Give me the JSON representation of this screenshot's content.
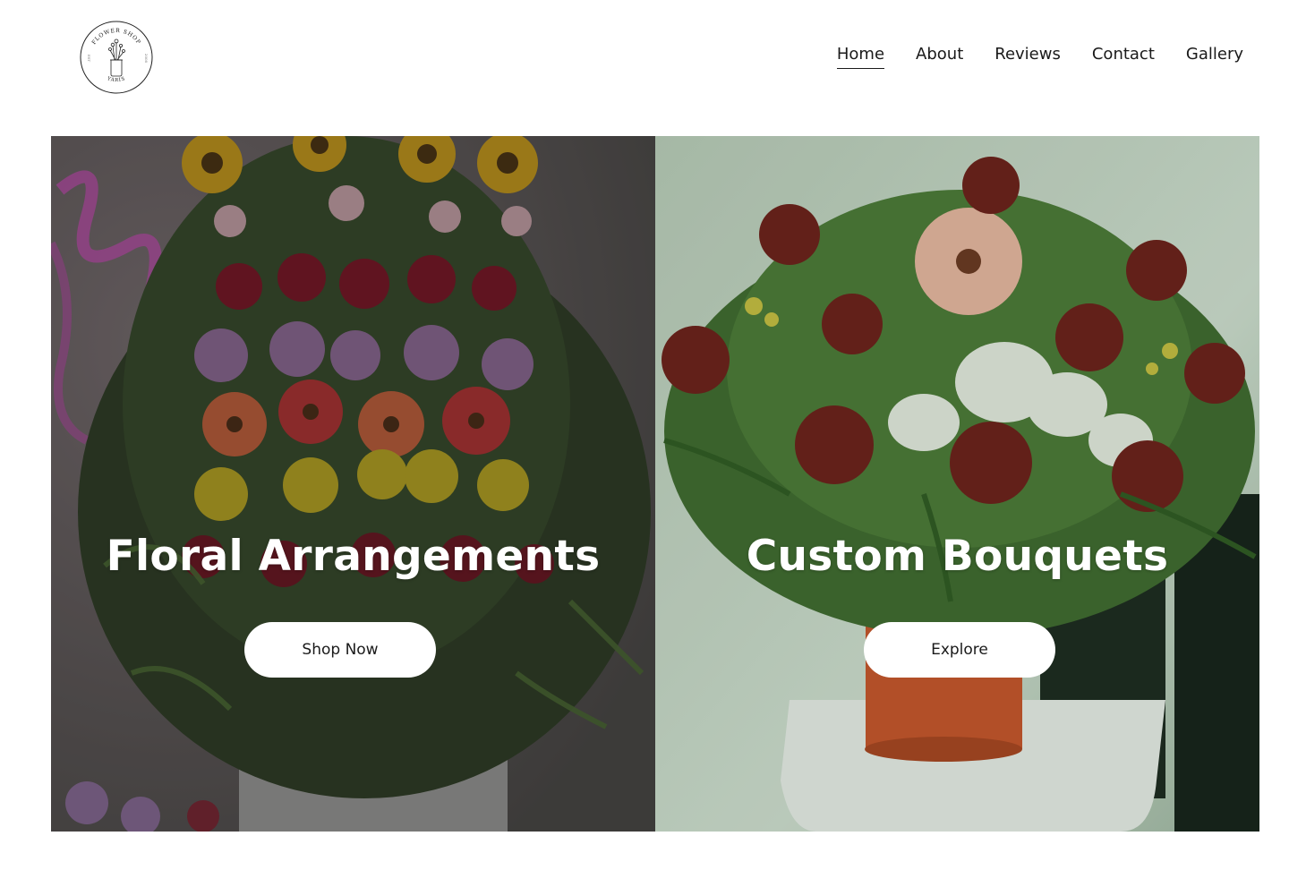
{
  "logo": {
    "top_text": "FLOWER SHOP",
    "bottom_text": "YARIS",
    "left_text": "EST",
    "right_text": "2008",
    "icon": "flower-vase-icon"
  },
  "nav": {
    "items": [
      {
        "label": "Home",
        "active": true
      },
      {
        "label": "About",
        "active": false
      },
      {
        "label": "Reviews",
        "active": false
      },
      {
        "label": "Contact",
        "active": false
      },
      {
        "label": "Gallery",
        "active": false
      }
    ]
  },
  "panels": [
    {
      "title": "Floral Arrangements",
      "button_label": "Shop Now",
      "image": "flower-arrangement-photo"
    },
    {
      "title": "Custom Bouquets",
      "button_label": "Explore",
      "image": "rose-bouquet-photo"
    }
  ],
  "colors": {
    "text": "#1a1a1a",
    "button_bg": "#ffffff",
    "title_text": "#ffffff"
  }
}
